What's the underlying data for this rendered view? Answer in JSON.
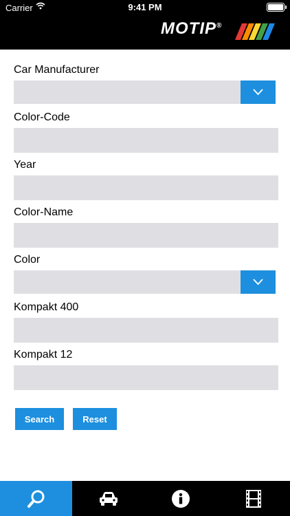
{
  "status_bar": {
    "carrier": "Carrier",
    "time": "9:41 PM"
  },
  "brand": {
    "logo_text": "MOTIP",
    "registered_mark": "®"
  },
  "form": {
    "fields": [
      {
        "label": "Car Manufacturer",
        "type": "select",
        "value": ""
      },
      {
        "label": "Color-Code",
        "type": "text",
        "value": ""
      },
      {
        "label": "Year",
        "type": "text",
        "value": ""
      },
      {
        "label": "Color-Name",
        "type": "text",
        "value": ""
      },
      {
        "label": "Color",
        "type": "select",
        "value": ""
      },
      {
        "label": "Kompakt 400",
        "type": "text",
        "value": ""
      },
      {
        "label": "Kompakt 12",
        "type": "text",
        "value": ""
      }
    ],
    "buttons": {
      "search": "Search",
      "reset": "Reset"
    }
  },
  "tabbar": {
    "tabs": [
      {
        "icon": "search-icon",
        "active": true
      },
      {
        "icon": "car-icon",
        "active": false
      },
      {
        "icon": "info-icon",
        "active": false
      },
      {
        "icon": "film-icon",
        "active": false
      }
    ]
  },
  "colors": {
    "accent": "#1d8fde",
    "field_bg": "#dfdfe3",
    "header_bg": "#000000"
  }
}
